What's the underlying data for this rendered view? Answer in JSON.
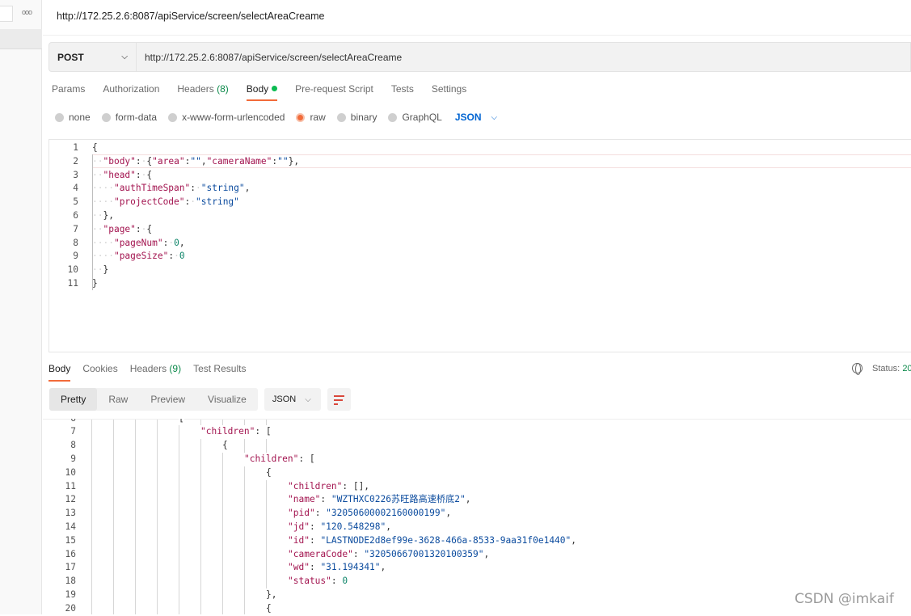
{
  "window": {
    "title": "http://172.25.2.6:8087/apiService/screen/selectAreaCreame",
    "more_icon": "ooo"
  },
  "request": {
    "method": "POST",
    "url": "http://172.25.2.6:8087/apiService/screen/selectAreaCreame",
    "tabs": [
      {
        "label": "Params"
      },
      {
        "label": "Authorization"
      },
      {
        "label": "Headers",
        "count": "(8)"
      },
      {
        "label": "Body",
        "active": true
      },
      {
        "label": "Pre-request Script"
      },
      {
        "label": "Tests"
      },
      {
        "label": "Settings"
      }
    ],
    "body_modes": [
      {
        "label": "none"
      },
      {
        "label": "form-data"
      },
      {
        "label": "x-www-form-urlencoded"
      },
      {
        "label": "raw",
        "selected": true
      },
      {
        "label": "binary"
      },
      {
        "label": "GraphQL"
      }
    ],
    "format": "JSON",
    "code": [
      [
        [
          "p",
          "{"
        ]
      ],
      [
        [
          "ws",
          "··"
        ],
        [
          "k",
          "\"body\""
        ],
        [
          "p",
          ":"
        ],
        [
          "ws",
          "·"
        ],
        [
          "p",
          "{"
        ],
        [
          "k",
          "\"area\""
        ],
        [
          "p",
          ":"
        ],
        [
          "s",
          "\"\""
        ],
        [
          "p",
          ","
        ],
        [
          "k",
          "\"cameraName\""
        ],
        [
          "p",
          ":"
        ],
        [
          "s",
          "\"\""
        ],
        [
          "p",
          "},"
        ]
      ],
      [
        [
          "ws",
          "··"
        ],
        [
          "k",
          "\"head\""
        ],
        [
          "p",
          ":"
        ],
        [
          "ws",
          "·"
        ],
        [
          "p",
          "{"
        ]
      ],
      [
        [
          "ws",
          "····"
        ],
        [
          "k",
          "\"authTimeSpan\""
        ],
        [
          "p",
          ":"
        ],
        [
          "ws",
          "·"
        ],
        [
          "s",
          "\"string\""
        ],
        [
          "p",
          ","
        ]
      ],
      [
        [
          "ws",
          "····"
        ],
        [
          "k",
          "\"projectCode\""
        ],
        [
          "p",
          ":"
        ],
        [
          "ws",
          "·"
        ],
        [
          "s",
          "\"string\""
        ]
      ],
      [
        [
          "ws",
          "··"
        ],
        [
          "p",
          "},"
        ]
      ],
      [
        [
          "ws",
          "··"
        ],
        [
          "k",
          "\"page\""
        ],
        [
          "p",
          ":"
        ],
        [
          "ws",
          "·"
        ],
        [
          "p",
          "{"
        ]
      ],
      [
        [
          "ws",
          "····"
        ],
        [
          "k",
          "\"pageNum\""
        ],
        [
          "p",
          ":"
        ],
        [
          "ws",
          "·"
        ],
        [
          "n",
          "0"
        ],
        [
          "p",
          ","
        ]
      ],
      [
        [
          "ws",
          "····"
        ],
        [
          "k",
          "\"pageSize\""
        ],
        [
          "p",
          ":"
        ],
        [
          "ws",
          "·"
        ],
        [
          "n",
          "0"
        ]
      ],
      [
        [
          "ws",
          "··"
        ],
        [
          "p",
          "}"
        ]
      ],
      [
        [
          "p",
          "}"
        ]
      ]
    ]
  },
  "response": {
    "tabs": [
      {
        "label": "Body",
        "active": true
      },
      {
        "label": "Cookies"
      },
      {
        "label": "Headers",
        "count": "(9)"
      },
      {
        "label": "Test Results"
      }
    ],
    "status_label": "Status:",
    "status_value": "20",
    "views": [
      {
        "label": "Pretty",
        "active": true
      },
      {
        "label": "Raw"
      },
      {
        "label": "Preview"
      },
      {
        "label": "Visualize"
      }
    ],
    "format": "JSON",
    "first_line": 6,
    "code": [
      {
        "i": 4,
        "t": [
          [
            "p",
            "["
          ]
        ]
      },
      {
        "i": 5,
        "t": [
          [
            "k",
            "\"children\""
          ],
          [
            "p",
            ": ["
          ]
        ]
      },
      {
        "i": 6,
        "t": [
          [
            "p",
            "{"
          ]
        ]
      },
      {
        "i": 7,
        "t": [
          [
            "k",
            "\"children\""
          ],
          [
            "p",
            ": ["
          ]
        ]
      },
      {
        "i": 8,
        "t": [
          [
            "p",
            "{"
          ]
        ]
      },
      {
        "i": 9,
        "t": [
          [
            "k",
            "\"children\""
          ],
          [
            "p",
            ": [],"
          ]
        ]
      },
      {
        "i": 9,
        "t": [
          [
            "k",
            "\"name\""
          ],
          [
            "p",
            ": "
          ],
          [
            "s",
            "\"WZTHXC0226苏旺路高速桥底2\""
          ],
          [
            "p",
            ","
          ]
        ]
      },
      {
        "i": 9,
        "t": [
          [
            "k",
            "\"pid\""
          ],
          [
            "p",
            ": "
          ],
          [
            "s",
            "\"32050600002160000199\""
          ],
          [
            "p",
            ","
          ]
        ]
      },
      {
        "i": 9,
        "t": [
          [
            "k",
            "\"jd\""
          ],
          [
            "p",
            ": "
          ],
          [
            "s",
            "\"120.548298\""
          ],
          [
            "p",
            ","
          ]
        ]
      },
      {
        "i": 9,
        "t": [
          [
            "k",
            "\"id\""
          ],
          [
            "p",
            ": "
          ],
          [
            "s",
            "\"LASTNODE2d8ef99e-3628-466a-8533-9aa31f0e1440\""
          ],
          [
            "p",
            ","
          ]
        ]
      },
      {
        "i": 9,
        "t": [
          [
            "k",
            "\"cameraCode\""
          ],
          [
            "p",
            ": "
          ],
          [
            "s",
            "\"32050667001320100359\""
          ],
          [
            "p",
            ","
          ]
        ]
      },
      {
        "i": 9,
        "t": [
          [
            "k",
            "\"wd\""
          ],
          [
            "p",
            ": "
          ],
          [
            "s",
            "\"31.194341\""
          ],
          [
            "p",
            ","
          ]
        ]
      },
      {
        "i": 9,
        "t": [
          [
            "k",
            "\"status\""
          ],
          [
            "p",
            ": "
          ],
          [
            "n",
            "0"
          ]
        ]
      },
      {
        "i": 8,
        "t": [
          [
            "p",
            "},"
          ]
        ]
      },
      {
        "i": 8,
        "t": [
          [
            "p",
            "{"
          ]
        ]
      }
    ]
  },
  "watermark": "CSDN @imkaif"
}
